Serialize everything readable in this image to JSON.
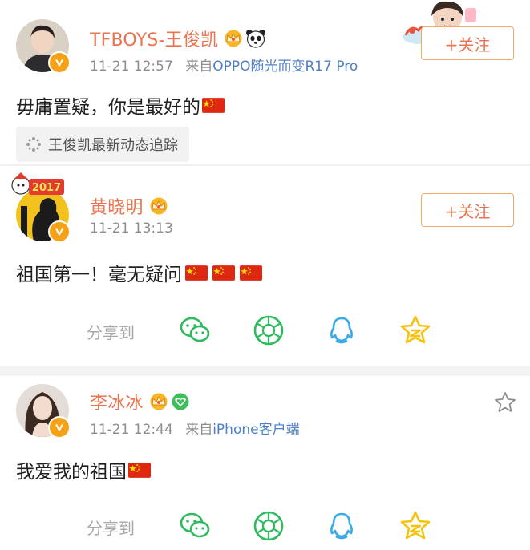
{
  "posts": [
    {
      "name": "TFBOYS-王俊凯",
      "time": "11-21 12:57",
      "source_prefix": "来自",
      "device": "OPPO随光而变R17 Pro",
      "follow_label": "+关注",
      "content": "毋庸置疑，你是最好的",
      "topic": "王俊凯最新动态追踪"
    },
    {
      "name": "黄晓明",
      "time": "11-21 13:13",
      "follow_label": "+关注",
      "avatar_banner": "2017",
      "content": "祖国第一！毫无疑问",
      "share_label": "分享到"
    },
    {
      "name": "李冰冰",
      "time": "11-21 12:44",
      "source_prefix": "来自",
      "device": "iPhone客户端",
      "content": "我爱我的祖国",
      "share_label": "分享到"
    }
  ],
  "icons": {
    "crown": "crown-icon",
    "panda": "panda-icon",
    "verified": "verified-v-icon",
    "flag": "china-flag-icon",
    "wechat": "wechat-icon",
    "moments": "moments-icon",
    "qq": "qq-icon",
    "qzone": "qzone-star-icon",
    "favorite": "star-outline-icon",
    "topic": "topic-sparkle-icon"
  },
  "colors": {
    "name": "#eb7350",
    "link": "#4f7fc6",
    "meta": "#8d8d8d",
    "verified": "#f7a116",
    "wechat": "#2dbb5d",
    "qq": "#3aa9e8",
    "qzone": "#f5c20f"
  }
}
